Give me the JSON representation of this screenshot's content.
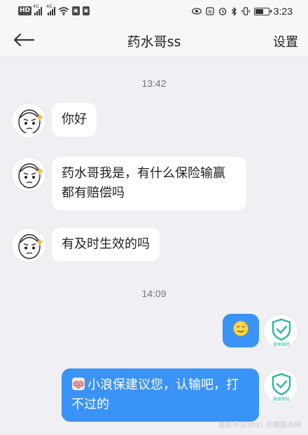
{
  "status_bar": {
    "badges": [
      "HD",
      "HD"
    ],
    "network": [
      "4G",
      "4G"
    ],
    "time": "3:23",
    "battery_level": 0.65
  },
  "nav": {
    "title": "药水哥ss",
    "settings_label": "设置"
  },
  "timestamps": [
    "13:42",
    "14:09"
  ],
  "incoming": [
    {
      "text": "你好",
      "avatar": "meme-face-avatar"
    },
    {
      "text": "药水哥我是，有什么保险输赢都有赔偿吗",
      "avatar": "meme-face-avatar"
    },
    {
      "text": "有及时生效的吗",
      "avatar": "meme-face-avatar"
    }
  ],
  "outgoing": [
    {
      "emoji": "sweat-smile-emoji",
      "avatar": "insurance-shield-avatar",
      "avatar_caption": "微保保险"
    },
    {
      "text": "小浪保建议您，认输吧，打不过的",
      "emoji": "cartoon-mascot-emoji",
      "avatar": "insurance-shield-avatar",
      "avatar_caption": "微保保险"
    }
  ],
  "colors": {
    "chat_bg": "#efeff4",
    "outgoing_bubble": "#3a93f6",
    "incoming_bubble": "#ffffff",
    "shield": "#2bb5a6"
  },
  "watermark": "搜狐号@3091 药理服务网"
}
